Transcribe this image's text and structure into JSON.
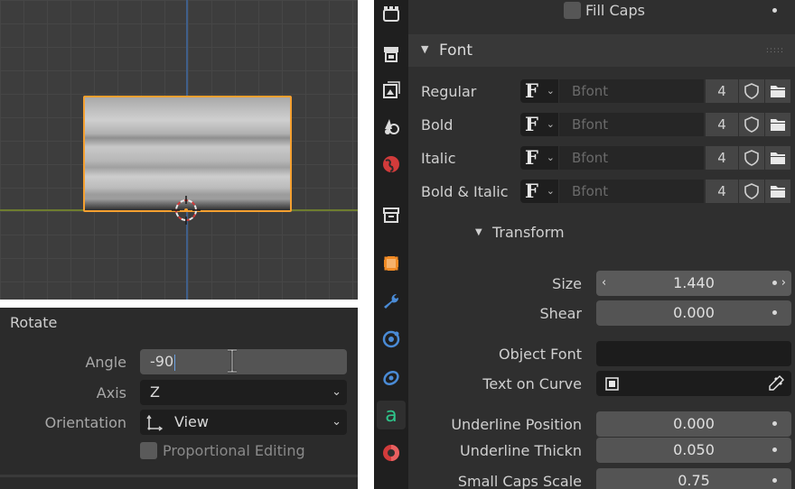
{
  "operator_panel": {
    "title": "Rotate",
    "angle": {
      "label": "Angle",
      "value": "-90"
    },
    "axis": {
      "label": "Axis",
      "value": "Z"
    },
    "orientation": {
      "label": "Orientation",
      "value": "View"
    },
    "proportional_editing": {
      "label": "Proportional Editing",
      "checked": false
    }
  },
  "properties": {
    "tabs": [
      {
        "icon": "render-icon",
        "active": false
      },
      {
        "icon": "output-icon",
        "active": false
      },
      {
        "icon": "view-layer-icon",
        "active": false
      },
      {
        "icon": "scene-icon",
        "active": false
      },
      {
        "icon": "world-icon",
        "active": false
      },
      {
        "icon": "collection-icon",
        "active": false
      },
      {
        "icon": "object-icon",
        "active": false
      },
      {
        "icon": "modifier-icon",
        "active": false
      },
      {
        "icon": "physics-icon",
        "active": false
      },
      {
        "icon": "constraint-icon",
        "active": false
      },
      {
        "icon": "text-data-icon",
        "active": true
      },
      {
        "icon": "material-icon",
        "active": false
      }
    ],
    "fill_caps": {
      "label": "Fill Caps",
      "checked": false
    },
    "font_panel": {
      "title": "Font",
      "fonts": [
        {
          "label": "Regular",
          "font": "Bfont",
          "users": "4"
        },
        {
          "label": "Bold",
          "font": "Bfont",
          "users": "4"
        },
        {
          "label": "Italic",
          "font": "Bfont",
          "users": "4"
        },
        {
          "label": "Bold & Italic",
          "font": "Bfont",
          "users": "4"
        }
      ],
      "picker_glyph": "F"
    },
    "transform": {
      "title": "Transform",
      "size": {
        "label": "Size",
        "value": "1.440"
      },
      "shear": {
        "label": "Shear",
        "value": "0.000"
      },
      "object_font": {
        "label": "Object Font",
        "value": ""
      },
      "text_on_curve": {
        "label": "Text on Curve",
        "value": ""
      },
      "underline_position": {
        "label": "Underline Position",
        "value": "0.000"
      },
      "underline_thickness": {
        "label": "Underline Thickn",
        "value": "0.050"
      },
      "small_caps_scale": {
        "label": "Small Caps Scale",
        "value": "0.75"
      }
    }
  },
  "colors": {
    "selection_outline": "#f5a030",
    "viewport_bg": "#3d3d3d",
    "z_axis": "#3f5f8a",
    "x_axis": "#6e7d2f",
    "panel_bg": "#2f2f2f",
    "field_bg": "#545454"
  }
}
